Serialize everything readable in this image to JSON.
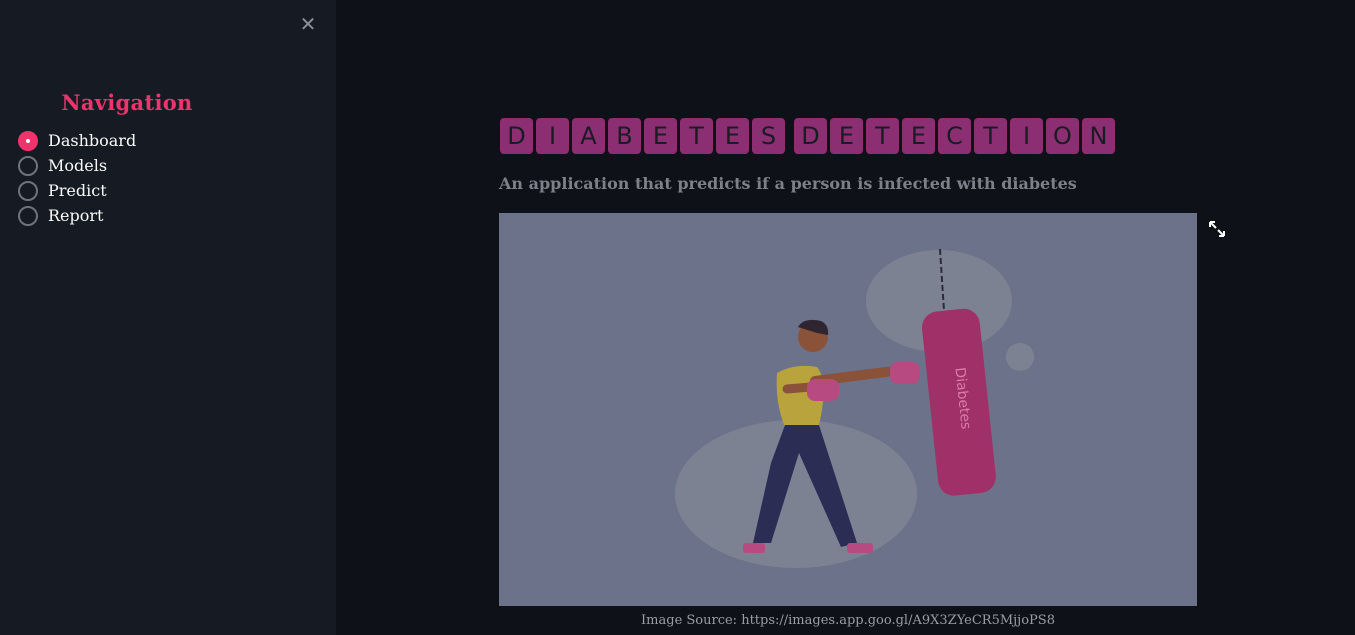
{
  "sidebar": {
    "close_icon": "close-icon",
    "title": "Navigation",
    "title_dots": "́ ́ ́ ́ ́ ́ ́ ́",
    "radio_options": [
      {
        "label": "Dashboard",
        "selected": true
      },
      {
        "label": "Models",
        "selected": false
      },
      {
        "label": "Predict",
        "selected": false
      },
      {
        "label": "Report",
        "selected": false
      }
    ],
    "accent_color": "#f0336d"
  },
  "main": {
    "title_letters": [
      "D",
      "I",
      "A",
      "B",
      "E",
      "T",
      "E",
      "S",
      " ",
      "D",
      "E",
      "T",
      "E",
      "C",
      "T",
      "I",
      "O",
      "N"
    ],
    "subtitle": "An application that predicts if a person is infected with diabetes",
    "image": {
      "bag_text": "Diabetes",
      "caption": "Image Source: https://images.app.goo.gl/A9X3ZYeCR5MjjoPS8",
      "expand_icon": "expand-icon"
    },
    "tile_color": "#8c2f72",
    "background": "#0e1117"
  }
}
